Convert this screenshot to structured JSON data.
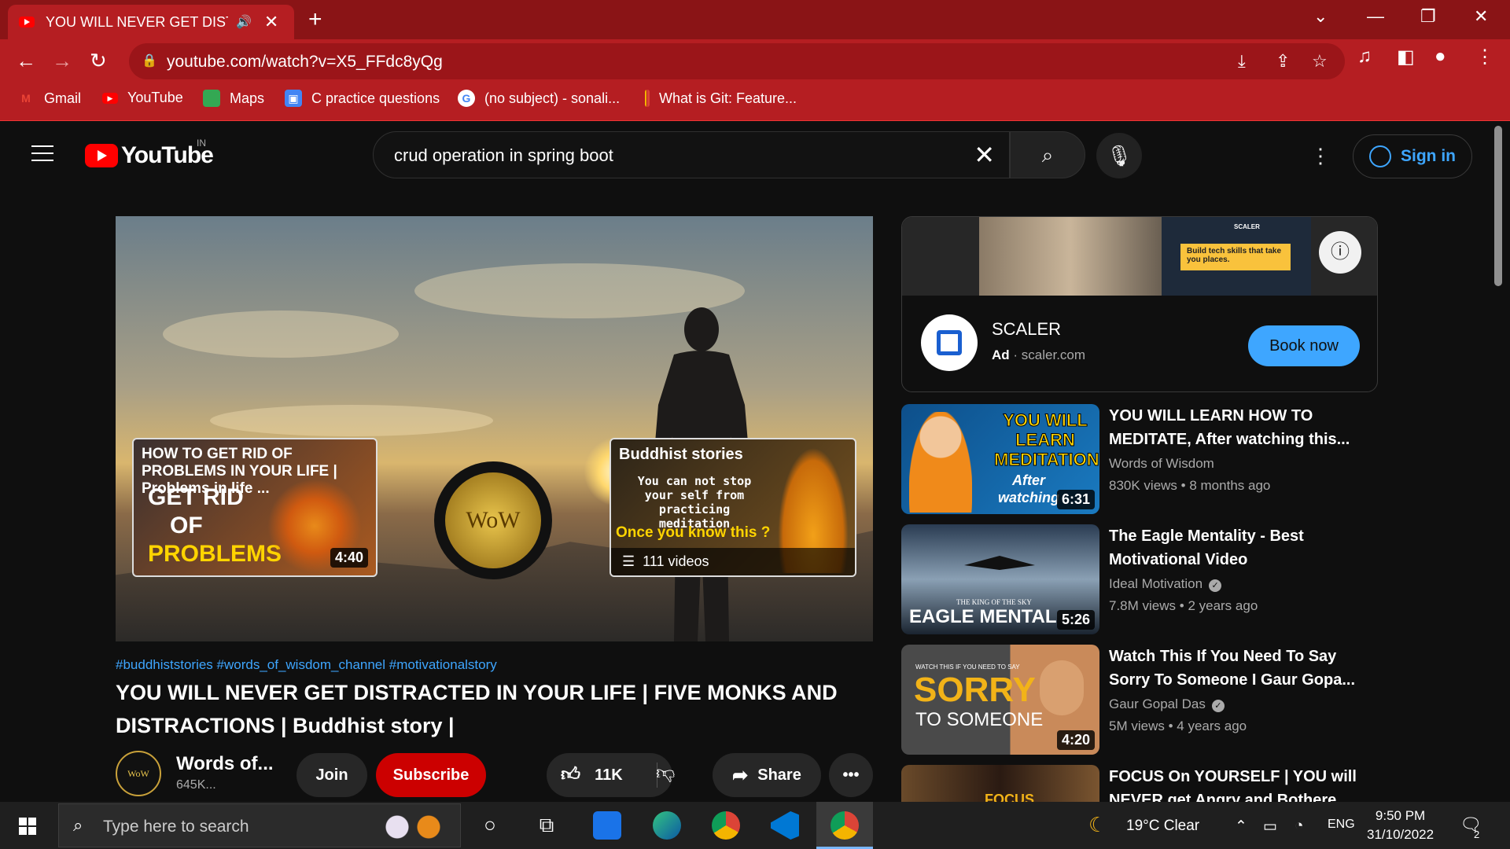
{
  "browser": {
    "tab_title": "YOU WILL NEVER GET DISTRA",
    "url": "youtube.com/watch?v=X5_FFdc8yQg"
  },
  "bookmarks": [
    {
      "label": "Gmail"
    },
    {
      "label": "YouTube"
    },
    {
      "label": "Maps"
    },
    {
      "label": "C practice questions"
    },
    {
      "label": "(no subject) - sonali..."
    },
    {
      "label": "What is Git: Feature..."
    }
  ],
  "yt": {
    "logo_text": "YouTube",
    "country": "IN",
    "search_query": "crud operation in spring boot",
    "sign_in": "Sign in"
  },
  "player": {
    "endcard1": {
      "title": "HOW TO GET RID OF PROBLEMS IN YOUR LIFE | Problems in life ...",
      "line1": "GET RID",
      "line2": "OF",
      "line3": "PROBLEMS",
      "duration": "4:40"
    },
    "endcard2": {
      "logo": "WoW"
    },
    "endcard3": {
      "title": "Buddhist stories",
      "desc": "You can not stop your self from practicing meditation",
      "kicker": "Once you know this ?",
      "count": "111 videos"
    }
  },
  "video": {
    "tags": "#buddhiststories #words_of_wisdom_channel #motivationalstory",
    "title": "YOU WILL NEVER GET DISTRACTED IN YOUR LIFE | FIVE MONKS AND DISTRACTIONS | Buddhist story |",
    "channel": "Words of...",
    "channel_avatar": "WoW",
    "subscribers": "645K...",
    "join": "Join",
    "subscribe": "Subscribe",
    "likes": "11K",
    "share": "Share"
  },
  "ad": {
    "banner_text": "Build tech skills that take you places.",
    "banner_brand": "SCALER",
    "name": "SCALER",
    "label": "Ad",
    "domain": "scaler.com",
    "cta": "Book now"
  },
  "recommendations": [
    {
      "title": "YOU WILL LEARN HOW TO MEDITATE, After watching this...",
      "channel": "Words of Wisdom",
      "views": "830K views",
      "age": "8 months ago",
      "duration": "6:31",
      "thumb_text": "YOU WILL LEARN MEDITATION",
      "thumb_sub": "After watching",
      "verified": false
    },
    {
      "title": "The Eagle Mentality - Best Motivational Video",
      "channel": "Ideal Motivation",
      "views": "7.8M views",
      "age": "2 years ago",
      "duration": "5:26",
      "thumb_text": "EAGLE MENTAL",
      "thumb_sub": "THE KING OF THE SKY",
      "verified": true
    },
    {
      "title": "Watch This If You Need To Say Sorry To Someone I Gaur Gopa...",
      "channel": "Gaur Gopal Das",
      "views": "5M views",
      "age": "4 years ago",
      "duration": "4:20",
      "thumb_text": "SORRY",
      "thumb_sub": "TO SOMEONE",
      "thumb_top": "WATCH THIS IF YOU NEED TO SAY",
      "verified": true
    },
    {
      "title": "FOCUS On YOURSELF | YOU will NEVER get Angry and Bothere...",
      "thumb_text": "FOCUS"
    }
  ],
  "taskbar": {
    "search_placeholder": "Type here to search",
    "weather": "19°C  Clear",
    "lang": "ENG",
    "time": "9:50 PM",
    "date": "31/10/2022",
    "notif_count": "2"
  }
}
